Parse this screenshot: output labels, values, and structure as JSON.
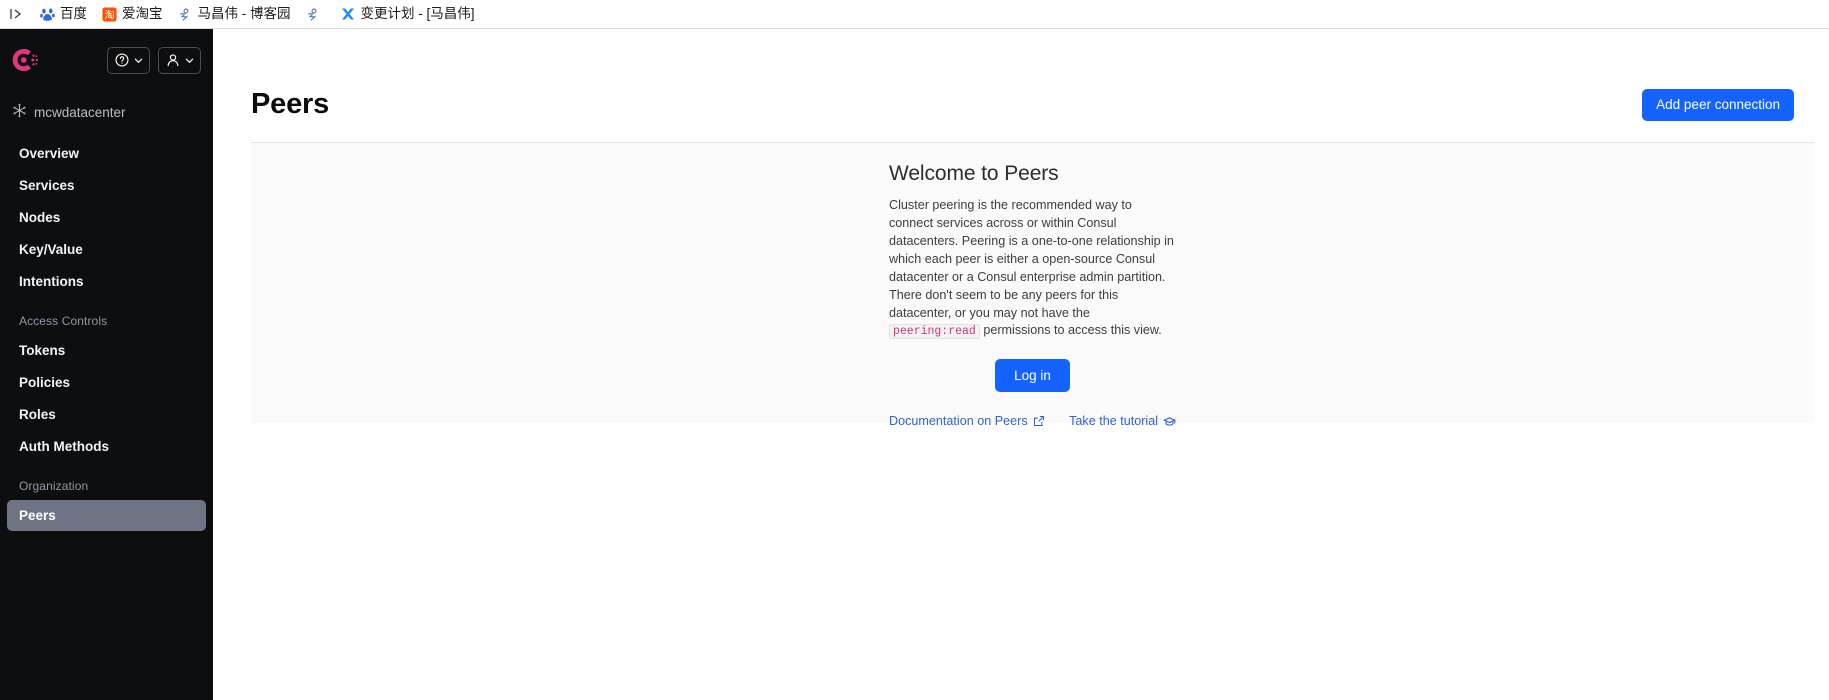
{
  "browser": {
    "bookmarks": [
      {
        "icon": "baidu-paw-icon",
        "label": "百度"
      },
      {
        "icon": "taobao-icon",
        "label": "爱淘宝"
      },
      {
        "icon": "cnblogs-icon",
        "label": "马昌伟 - 博客园"
      },
      {
        "icon": "cnblogs-icon-2",
        "label": ""
      },
      {
        "icon": "xmind-icon",
        "label": "变更计划 - [马昌伟]"
      }
    ]
  },
  "sidebar": {
    "logo_name": "consul-logo",
    "help_button_label": "",
    "user_button_label": "",
    "datacenter": "mcwdatacenter",
    "nav": [
      {
        "label": "Overview",
        "active": false
      },
      {
        "label": "Services",
        "active": false
      },
      {
        "label": "Nodes",
        "active": false
      },
      {
        "label": "Key/Value",
        "active": false
      },
      {
        "label": "Intentions",
        "active": false
      }
    ],
    "section_access_controls": "Access Controls",
    "nav_access": [
      {
        "label": "Tokens",
        "active": false
      },
      {
        "label": "Policies",
        "active": false
      },
      {
        "label": "Roles",
        "active": false
      },
      {
        "label": "Auth Methods",
        "active": false
      }
    ],
    "section_organization": "Organization",
    "nav_org": [
      {
        "label": "Peers",
        "active": true
      }
    ]
  },
  "main": {
    "page_title": "Peers",
    "add_peer_button": "Add peer connection",
    "empty_state": {
      "title": "Welcome to Peers",
      "body_part1": "Cluster peering is the recommended way to connect services across or within Consul datacenters. Peering is a one-to-one relationship in which each peer is either a open-source Consul datacenter or a Consul enterprise admin partition. There don't seem to be any peers for this datacenter, or you may not have the ",
      "body_code": "peering:read",
      "body_part2": " permissions to access this view.",
      "login_button": "Log in",
      "doc_link": "Documentation on Peers",
      "tutorial_link": "Take the tutorial"
    }
  },
  "colors": {
    "accent_blue": "#1563ff",
    "sidebar_bg": "#0d0e10",
    "active_nav_bg": "#6e7484",
    "consul_pink": "#e0367a",
    "code_pink": "#d63384",
    "link_blue": "#2f63d8"
  }
}
